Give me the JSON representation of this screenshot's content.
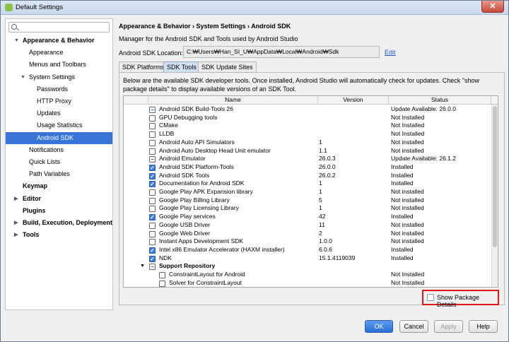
{
  "window": {
    "title": "Default Settings",
    "close_label": "✕"
  },
  "search": {
    "placeholder": ""
  },
  "sidebar": {
    "items": [
      {
        "label": "Appearance & Behavior",
        "level": 0,
        "bold": true,
        "arrow": "▼"
      },
      {
        "label": "Appearance",
        "level": 1,
        "bold": false,
        "arrow": ""
      },
      {
        "label": "Menus and Toolbars",
        "level": 1,
        "bold": false,
        "arrow": ""
      },
      {
        "label": "System Settings",
        "level": 1,
        "bold": false,
        "arrow": "▼"
      },
      {
        "label": "Passwords",
        "level": 2,
        "bold": false,
        "arrow": ""
      },
      {
        "label": "HTTP Proxy",
        "level": 2,
        "bold": false,
        "arrow": ""
      },
      {
        "label": "Updates",
        "level": 2,
        "bold": false,
        "arrow": ""
      },
      {
        "label": "Usage Statistics",
        "level": 2,
        "bold": false,
        "arrow": ""
      },
      {
        "label": "Android SDK",
        "level": 2,
        "bold": false,
        "arrow": "",
        "selected": true
      },
      {
        "label": "Notifications",
        "level": 1,
        "bold": false,
        "arrow": ""
      },
      {
        "label": "Quick Lists",
        "level": 1,
        "bold": false,
        "arrow": ""
      },
      {
        "label": "Path Variables",
        "level": 1,
        "bold": false,
        "arrow": ""
      },
      {
        "label": "Keymap",
        "level": 0,
        "bold": true,
        "arrow": ""
      },
      {
        "label": "Editor",
        "level": 0,
        "bold": true,
        "arrow": "▶"
      },
      {
        "label": "Plugins",
        "level": 0,
        "bold": true,
        "arrow": ""
      },
      {
        "label": "Build, Execution, Deployment",
        "level": 0,
        "bold": true,
        "arrow": "▶"
      },
      {
        "label": "Tools",
        "level": 0,
        "bold": true,
        "arrow": "▶"
      }
    ]
  },
  "main": {
    "breadcrumb": "Appearance & Behavior › System Settings › Android SDK",
    "description": "Manager for the Android SDK and Tools used by Android Studio",
    "location_label": "Android SDK Location:",
    "location_value": "C:₩Users₩Han_SI_U₩AppData₩Local₩Android₩Sdk",
    "edit_label": "Edit",
    "tabs": [
      "SDK Platforms",
      "SDK Tools",
      "SDK Update Sites"
    ],
    "tools_desc": "Below are the available SDK developer tools. Once installed, Android Studio will automatically check for updates. Check \"show package details\" to display available versions of an SDK Tool.",
    "columns": [
      "Name",
      "Version",
      "Status"
    ],
    "rows": [
      {
        "name": "Android SDK Build-Tools 26",
        "version": "",
        "status": "Update Available: 26.0.0",
        "check": "partial",
        "indent": 0
      },
      {
        "name": "GPU Debugging tools",
        "version": "",
        "status": "Not Installed",
        "check": "none",
        "indent": 0
      },
      {
        "name": "CMake",
        "version": "",
        "status": "Not Installed",
        "check": "none",
        "indent": 0
      },
      {
        "name": "LLDB",
        "version": "",
        "status": "Not Installed",
        "check": "none",
        "indent": 0
      },
      {
        "name": "Android Auto API Simulators",
        "version": "1",
        "status": "Not installed",
        "check": "none",
        "indent": 0
      },
      {
        "name": "Android Auto Desktop Head Unit emulator",
        "version": "1.1",
        "status": "Not installed",
        "check": "none",
        "indent": 0
      },
      {
        "name": "Android Emulator",
        "version": "26.0.3",
        "status": "Update Available: 26.1.2",
        "check": "partial",
        "indent": 0
      },
      {
        "name": "Android SDK Platform-Tools",
        "version": "26.0.0",
        "status": "Installed",
        "check": "checked",
        "indent": 0
      },
      {
        "name": "Android SDK Tools",
        "version": "26.0.2",
        "status": "Installed",
        "check": "checked",
        "indent": 0
      },
      {
        "name": "Documentation for Android SDK",
        "version": "1",
        "status": "Installed",
        "check": "checked",
        "indent": 0
      },
      {
        "name": "Google Play APK Expansion library",
        "version": "1",
        "status": "Not installed",
        "check": "none",
        "indent": 0
      },
      {
        "name": "Google Play Billing Library",
        "version": "5",
        "status": "Not installed",
        "check": "none",
        "indent": 0
      },
      {
        "name": "Google Play Licensing Library",
        "version": "1",
        "status": "Not installed",
        "check": "none",
        "indent": 0
      },
      {
        "name": "Google Play services",
        "version": "42",
        "status": "Installed",
        "check": "checked",
        "indent": 0
      },
      {
        "name": "Google USB Driver",
        "version": "11",
        "status": "Not installed",
        "check": "none",
        "indent": 0
      },
      {
        "name": "Google Web Driver",
        "version": "2",
        "status": "Not installed",
        "check": "none",
        "indent": 0
      },
      {
        "name": "Instant Apps Development SDK",
        "version": "1.0.0",
        "status": "Not installed",
        "check": "none",
        "indent": 0
      },
      {
        "name": "Intel x86 Emulator Accelerator (HAXM installer)",
        "version": "6.0.6",
        "status": "Installed",
        "check": "checked",
        "indent": 0
      },
      {
        "name": "NDK",
        "version": "15.1.4119039",
        "status": "Installed",
        "check": "checked",
        "indent": 0
      },
      {
        "name": "Support Repository",
        "version": "",
        "status": "",
        "check": "partial",
        "indent": -1,
        "group": true,
        "arrow": "▼"
      },
      {
        "name": "ConstraintLayout for Android",
        "version": "",
        "status": "Not Installed",
        "check": "none",
        "indent": 1
      },
      {
        "name": "Solver for ConstraintLayout",
        "version": "",
        "status": "Not Installed",
        "check": "none",
        "indent": 1
      }
    ],
    "show_package_details": "Show Package Details"
  },
  "footer": {
    "ok": "OK",
    "cancel": "Cancel",
    "apply": "Apply",
    "help": "Help"
  },
  "colors": {
    "selection": "#3875d7",
    "highlight": "#e0161b",
    "link": "#2256c7"
  }
}
